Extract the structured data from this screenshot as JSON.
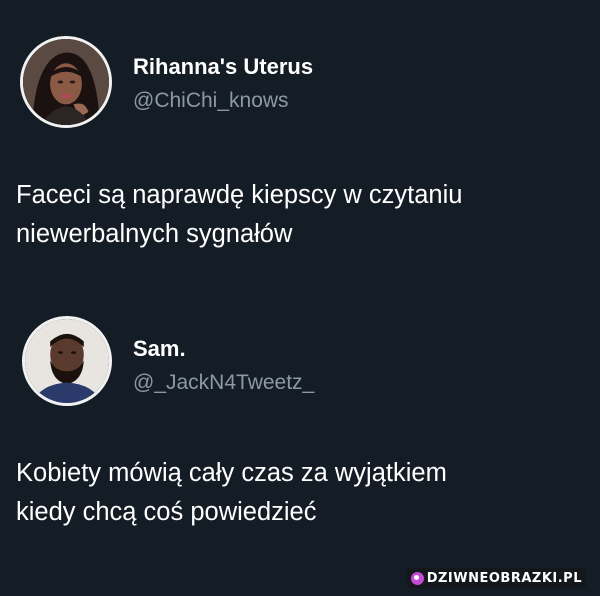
{
  "tweets": [
    {
      "display_name": "Rihanna's Uterus",
      "handle": "@ChiChi_knows",
      "text_lines": [
        "Faceci są naprawdę kiepscy w czytaniu",
        "niewerbalnych sygnałów"
      ]
    },
    {
      "display_name": "Sam.",
      "handle": "@_JackN4Tweetz_",
      "text_lines": [
        "Kobiety mówią cały czas za wyjątkiem",
        "kiedy chcą coś powiedzieć"
      ]
    }
  ],
  "watermark": {
    "text": "DZIWNEOBRAZKI.PL",
    "icon": "logo-icon"
  },
  "colors": {
    "background": "#141d26",
    "text": "#ffffff",
    "handle": "#8b98a5",
    "watermark_accent": "#c44ad6"
  }
}
